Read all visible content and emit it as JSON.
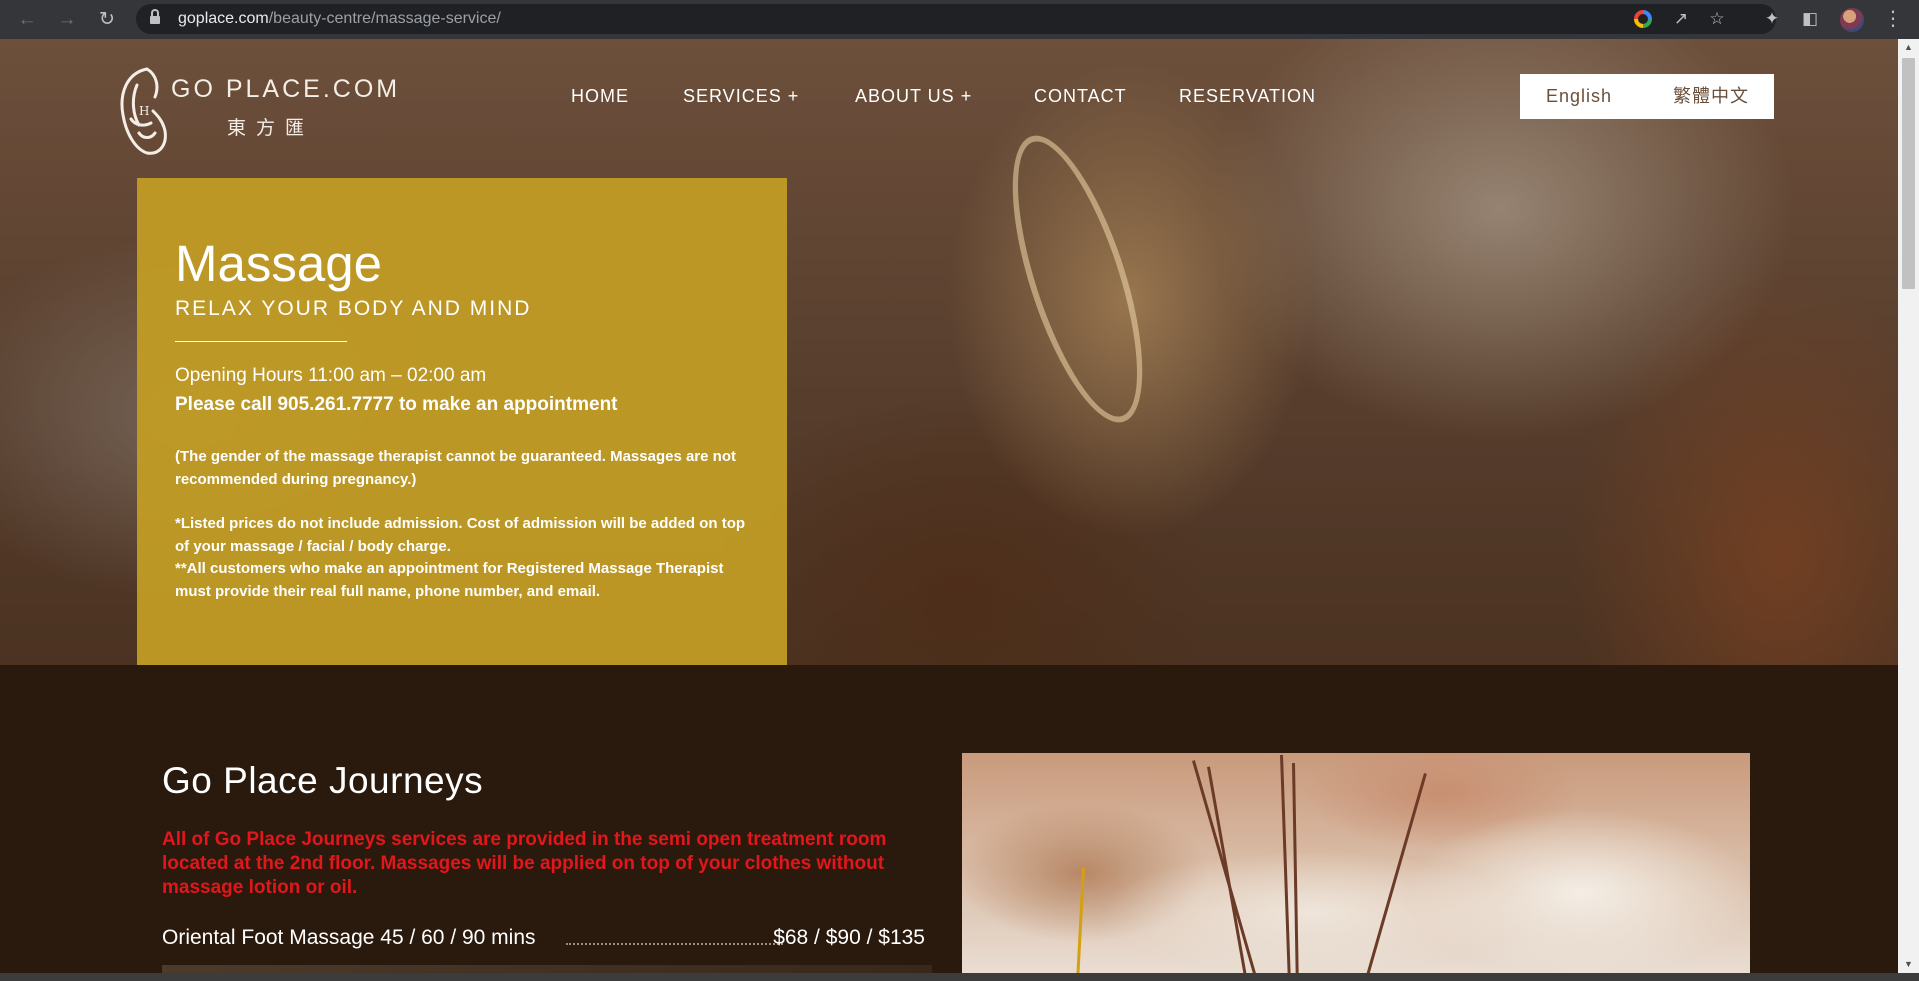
{
  "browser": {
    "url_host": "goplace.com",
    "url_path": "/beauty-centre/massage-service/",
    "icons": {
      "back": "back-arrow-icon",
      "forward": "forward-arrow-icon",
      "reload": "reload-icon",
      "lock": "lock-icon",
      "google": "google-lens-icon",
      "share": "share-icon",
      "bookmark": "star-icon",
      "extensions": "puzzle-icon",
      "side_panel": "side-panel-icon",
      "profile": "avatar",
      "menu": "kebab-menu-icon"
    }
  },
  "site": {
    "logo_text": "GO PLACE.COM",
    "logo_sub": "東方匯",
    "nav": [
      {
        "label": "HOME"
      },
      {
        "label": "SERVICES  +"
      },
      {
        "label": "ABOUT US  +"
      },
      {
        "label": "CONTACT"
      },
      {
        "label": "RESERVATION"
      }
    ],
    "languages": [
      "English",
      "繁體中文"
    ]
  },
  "hero": {
    "title": "Massage",
    "subtitle": "RELAX YOUR BODY AND MIND",
    "hours": "Opening Hours 11:00 am – 02:00 am",
    "call": "Please call 905.261.7777 to make an appointment",
    "note_gender": "(The gender of the massage therapist cannot be guaranteed. Massages are not recommended during pregnancy.)",
    "note_admission": "*Listed prices do not include admission. Cost of admission will be added on top of your massage / facial / body charge.",
    "note_rmt": "**All customers who make an appointment for Registered Massage Therapist must provide their real full name, phone number, and email."
  },
  "journeys": {
    "title": "Go Place Journeys",
    "alert": "All of Go Place Journeys services are provided in the semi open treatment room located at the 2nd floor. Massages will be applied on top of your clothes without massage lotion or oil.",
    "services": [
      {
        "name": "Oriental Foot Massage 45 / 60 / 90 mins",
        "price": "$68 / $90 / $135"
      }
    ]
  },
  "colors": {
    "card": "#c19c25",
    "alert": "#e2161b",
    "section_bg": "#2a1a0d"
  }
}
